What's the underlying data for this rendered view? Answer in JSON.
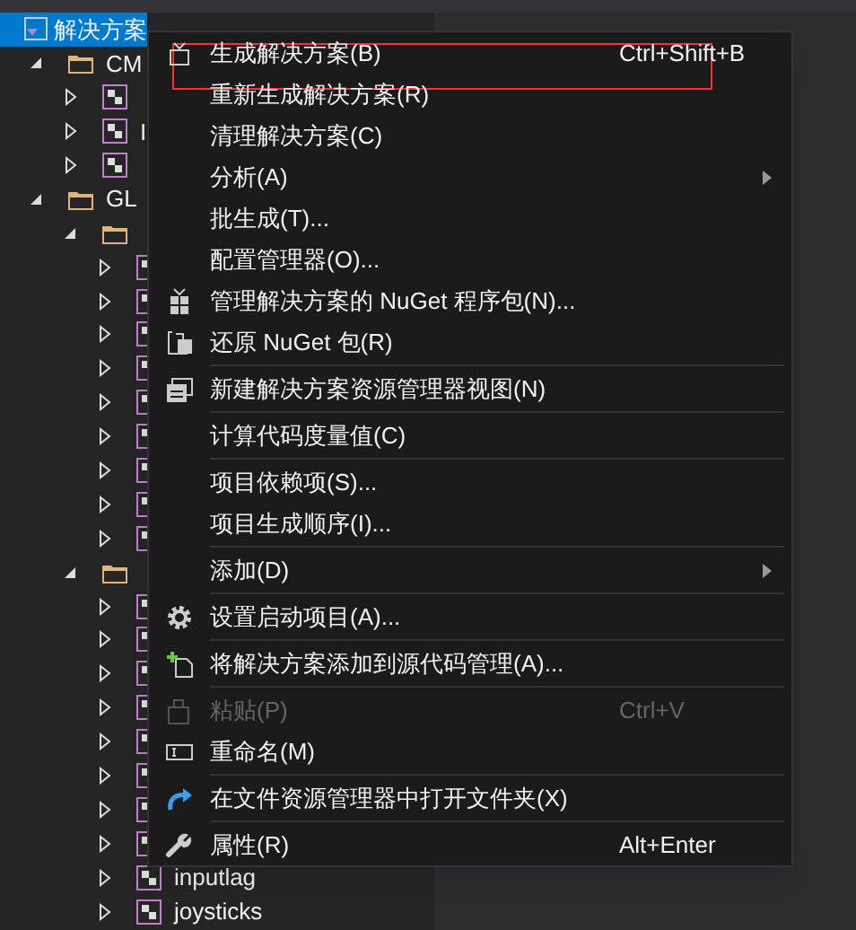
{
  "tree": [
    {
      "label": "解决方案",
      "kind": "solution",
      "selected": true,
      "children": [
        {
          "label": "CM",
          "kind": "folder",
          "expanded": true,
          "children": [
            {
              "kind": "project",
              "expanded": false
            },
            {
              "label": "I",
              "kind": "project",
              "expanded": false
            },
            {
              "kind": "project",
              "expanded": false
            }
          ]
        },
        {
          "label": "GL",
          "kind": "folder",
          "expanded": true,
          "children": [
            {
              "kind": "folder",
              "expanded": true,
              "children": [
                {
                  "kind": "project",
                  "expanded": false
                },
                {
                  "kind": "project",
                  "expanded": false
                },
                {
                  "kind": "project",
                  "expanded": false
                },
                {
                  "kind": "project",
                  "expanded": false
                },
                {
                  "kind": "project",
                  "expanded": false
                },
                {
                  "kind": "project",
                  "expanded": false
                },
                {
                  "kind": "project",
                  "expanded": false
                },
                {
                  "kind": "project",
                  "expanded": false
                },
                {
                  "kind": "project",
                  "expanded": false
                }
              ]
            },
            {
              "kind": "folder",
              "expanded": true,
              "children": [
                {
                  "kind": "project",
                  "expanded": false
                },
                {
                  "kind": "project",
                  "expanded": false
                },
                {
                  "kind": "project",
                  "expanded": false
                },
                {
                  "kind": "project",
                  "expanded": false
                },
                {
                  "kind": "project",
                  "expanded": false
                },
                {
                  "kind": "project",
                  "expanded": false
                },
                {
                  "kind": "project",
                  "expanded": false
                },
                {
                  "kind": "project",
                  "expanded": false
                },
                {
                  "label": "inputlag",
                  "kind": "project",
                  "expanded": false
                },
                {
                  "label": "joysticks",
                  "kind": "project",
                  "expanded": false
                }
              ]
            }
          ]
        }
      ]
    }
  ],
  "context_menu": [
    {
      "kind": "item",
      "label": "生成解决方案(B)",
      "shortcut": "Ctrl+Shift+B",
      "highlighted": true,
      "disabled": false
    },
    {
      "kind": "item",
      "label": "重新生成解决方案(R)",
      "disabled": false
    },
    {
      "kind": "item",
      "label": "清理解决方案(C)",
      "disabled": false
    },
    {
      "kind": "submenu",
      "label": "分析(A)",
      "disabled": false
    },
    {
      "kind": "item",
      "label": "批生成(T)...",
      "disabled": false
    },
    {
      "kind": "item",
      "label": "配置管理器(O)...",
      "disabled": false
    },
    {
      "kind": "item",
      "label": "管理解决方案的 NuGet 程序包(N)...",
      "disabled": false
    },
    {
      "kind": "item",
      "label": "还原 NuGet 包(R)",
      "disabled": false
    },
    {
      "kind": "separator"
    },
    {
      "kind": "item",
      "label": "新建解决方案资源管理器视图(N)",
      "disabled": false
    },
    {
      "kind": "separator"
    },
    {
      "kind": "item",
      "label": "计算代码度量值(C)",
      "disabled": false
    },
    {
      "kind": "separator"
    },
    {
      "kind": "item",
      "label": "项目依赖项(S)...",
      "disabled": false
    },
    {
      "kind": "item",
      "label": "项目生成顺序(I)...",
      "disabled": false
    },
    {
      "kind": "separator"
    },
    {
      "kind": "submenu",
      "label": "添加(D)",
      "disabled": false
    },
    {
      "kind": "separator"
    },
    {
      "kind": "item",
      "label": "设置启动项目(A)...",
      "disabled": false
    },
    {
      "kind": "separator"
    },
    {
      "kind": "item",
      "label": "将解决方案添加到源代码管理(A)...",
      "disabled": false
    },
    {
      "kind": "separator"
    },
    {
      "kind": "item",
      "label": "粘贴(P)",
      "shortcut": "Ctrl+V",
      "disabled": true
    },
    {
      "kind": "item",
      "label": "重命名(M)",
      "disabled": false
    },
    {
      "kind": "separator"
    },
    {
      "kind": "item",
      "label": "在文件资源管理器中打开文件夹(X)",
      "disabled": false
    },
    {
      "kind": "separator"
    },
    {
      "kind": "item",
      "label": "属性(R)",
      "shortcut": "Alt+Enter",
      "disabled": false
    }
  ]
}
